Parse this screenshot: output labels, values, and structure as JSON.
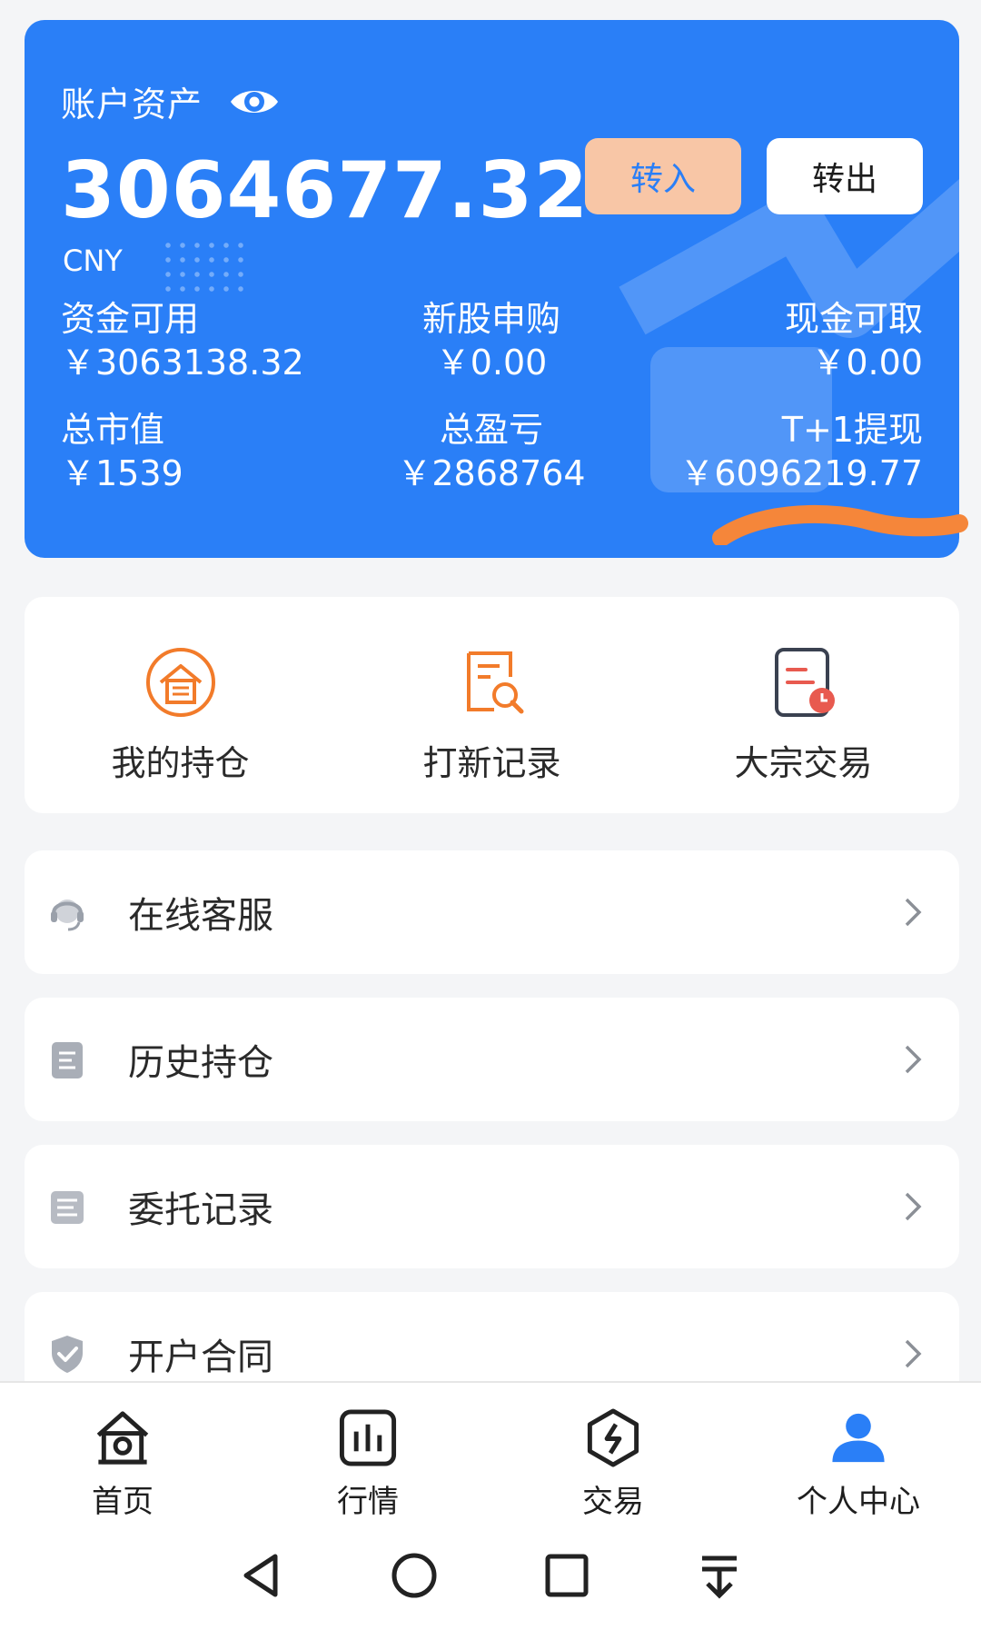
{
  "asset": {
    "title": "账户资产",
    "total": "3064677.32",
    "currency": "CNY",
    "transfer_in_label": "转入",
    "transfer_out_label": "转出",
    "stats": [
      {
        "label": "资金可用",
        "value": "￥3063138.32"
      },
      {
        "label": "新股申购",
        "value": "￥0.00"
      },
      {
        "label": "现金可取",
        "value": "￥0.00"
      },
      {
        "label": "总市值",
        "value": "￥1539"
      },
      {
        "label": "总盈亏",
        "value": "￥2868764"
      },
      {
        "label": "T+1提现",
        "value": "￥6096219.77"
      }
    ],
    "colors": {
      "card": "#2a7ff7",
      "btn_in_bg": "#f8c6a6",
      "scribble": "#f5863a"
    }
  },
  "quick": [
    {
      "label": "我的持仓",
      "icon": "house-holdings-icon"
    },
    {
      "label": "打新记录",
      "icon": "document-search-icon"
    },
    {
      "label": "大宗交易",
      "icon": "document-clock-icon"
    }
  ],
  "menu": [
    {
      "label": "在线客服",
      "icon": "headset-icon"
    },
    {
      "label": "历史持仓",
      "icon": "document-icon"
    },
    {
      "label": "委托记录",
      "icon": "list-document-icon"
    },
    {
      "label": "开户合同",
      "icon": "shield-check-icon"
    }
  ],
  "nav": [
    {
      "label": "首页",
      "icon": "home-icon"
    },
    {
      "label": "行情",
      "icon": "chart-icon"
    },
    {
      "label": "交易",
      "icon": "exchange-icon"
    },
    {
      "label": "个人中心",
      "icon": "person-icon",
      "active": true
    }
  ],
  "accent": "#2a7ff7",
  "icon_orange": "#f27b2a"
}
